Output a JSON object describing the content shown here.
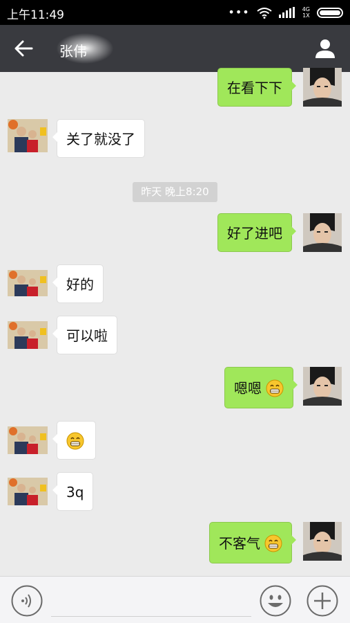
{
  "status_bar": {
    "time": "上午11:49",
    "more": "•••",
    "network_top": "4G",
    "network_bottom": "1X"
  },
  "nav": {
    "title": "张伟"
  },
  "timestamp": "昨天 晚上8:20",
  "messages": [
    {
      "side": "out",
      "text": "在看下下"
    },
    {
      "side": "in",
      "text": "关了就没了"
    },
    {
      "side": "out",
      "text": "好了进吧"
    },
    {
      "side": "in",
      "text": "好的"
    },
    {
      "side": "in",
      "text": "可以啦"
    },
    {
      "side": "out",
      "text": "嗯嗯",
      "emoji": "grin-emoji"
    },
    {
      "side": "in",
      "text": "",
      "emoji": "grin-emoji"
    },
    {
      "side": "in",
      "text": "3q"
    },
    {
      "side": "out",
      "text": "不客气",
      "emoji": "grin-emoji"
    }
  ],
  "colors": {
    "outgoing_bubble": "#a0e75a",
    "incoming_bubble": "#ffffff",
    "nav_bar": "#393a3f",
    "chat_background": "#ebebeb"
  },
  "icons": {
    "back": "back-arrow-icon",
    "contact": "person-icon",
    "voice": "voice-icon",
    "emoji": "smiley-icon",
    "plus": "plus-icon"
  }
}
